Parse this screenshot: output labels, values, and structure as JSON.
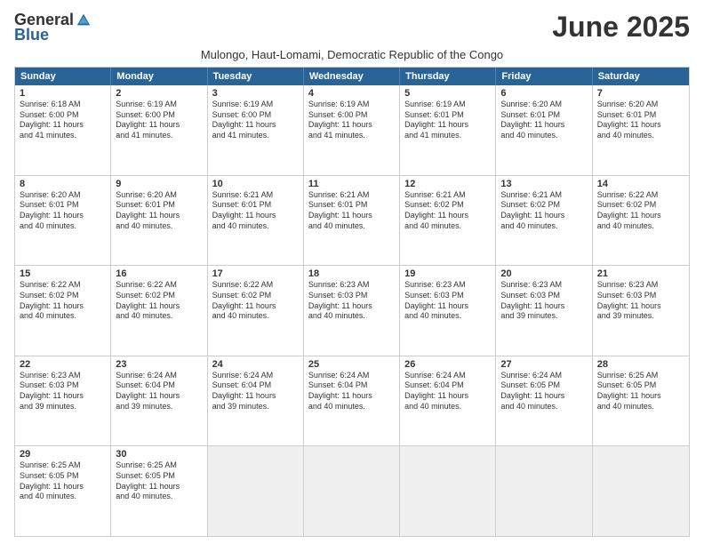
{
  "logo": {
    "general": "General",
    "blue": "Blue"
  },
  "title": "June 2025",
  "subtitle": "Mulongo, Haut-Lomami, Democratic Republic of the Congo",
  "header": {
    "days": [
      "Sunday",
      "Monday",
      "Tuesday",
      "Wednesday",
      "Thursday",
      "Friday",
      "Saturday"
    ]
  },
  "weeks": [
    [
      {
        "day": 1,
        "rise": "6:18 AM",
        "set": "6:00 PM",
        "hours": "11",
        "mins": "41"
      },
      {
        "day": 2,
        "rise": "6:19 AM",
        "set": "6:00 PM",
        "hours": "11",
        "mins": "41"
      },
      {
        "day": 3,
        "rise": "6:19 AM",
        "set": "6:00 PM",
        "hours": "11",
        "mins": "41"
      },
      {
        "day": 4,
        "rise": "6:19 AM",
        "set": "6:00 PM",
        "hours": "11",
        "mins": "41"
      },
      {
        "day": 5,
        "rise": "6:19 AM",
        "set": "6:01 PM",
        "hours": "11",
        "mins": "41"
      },
      {
        "day": 6,
        "rise": "6:20 AM",
        "set": "6:01 PM",
        "hours": "11",
        "mins": "40"
      },
      {
        "day": 7,
        "rise": "6:20 AM",
        "set": "6:01 PM",
        "hours": "11",
        "mins": "40"
      }
    ],
    [
      {
        "day": 8,
        "rise": "6:20 AM",
        "set": "6:01 PM",
        "hours": "11",
        "mins": "40"
      },
      {
        "day": 9,
        "rise": "6:20 AM",
        "set": "6:01 PM",
        "hours": "11",
        "mins": "40"
      },
      {
        "day": 10,
        "rise": "6:21 AM",
        "set": "6:01 PM",
        "hours": "11",
        "mins": "40"
      },
      {
        "day": 11,
        "rise": "6:21 AM",
        "set": "6:01 PM",
        "hours": "11",
        "mins": "40"
      },
      {
        "day": 12,
        "rise": "6:21 AM",
        "set": "6:02 PM",
        "hours": "11",
        "mins": "40"
      },
      {
        "day": 13,
        "rise": "6:21 AM",
        "set": "6:02 PM",
        "hours": "11",
        "mins": "40"
      },
      {
        "day": 14,
        "rise": "6:22 AM",
        "set": "6:02 PM",
        "hours": "11",
        "mins": "40"
      }
    ],
    [
      {
        "day": 15,
        "rise": "6:22 AM",
        "set": "6:02 PM",
        "hours": "11",
        "mins": "40"
      },
      {
        "day": 16,
        "rise": "6:22 AM",
        "set": "6:02 PM",
        "hours": "11",
        "mins": "40"
      },
      {
        "day": 17,
        "rise": "6:22 AM",
        "set": "6:02 PM",
        "hours": "11",
        "mins": "40"
      },
      {
        "day": 18,
        "rise": "6:23 AM",
        "set": "6:03 PM",
        "hours": "11",
        "mins": "40"
      },
      {
        "day": 19,
        "rise": "6:23 AM",
        "set": "6:03 PM",
        "hours": "11",
        "mins": "40"
      },
      {
        "day": 20,
        "rise": "6:23 AM",
        "set": "6:03 PM",
        "hours": "11",
        "mins": "39"
      },
      {
        "day": 21,
        "rise": "6:23 AM",
        "set": "6:03 PM",
        "hours": "11",
        "mins": "39"
      }
    ],
    [
      {
        "day": 22,
        "rise": "6:23 AM",
        "set": "6:03 PM",
        "hours": "11",
        "mins": "39"
      },
      {
        "day": 23,
        "rise": "6:24 AM",
        "set": "6:04 PM",
        "hours": "11",
        "mins": "39"
      },
      {
        "day": 24,
        "rise": "6:24 AM",
        "set": "6:04 PM",
        "hours": "11",
        "mins": "39"
      },
      {
        "day": 25,
        "rise": "6:24 AM",
        "set": "6:04 PM",
        "hours": "11",
        "mins": "40"
      },
      {
        "day": 26,
        "rise": "6:24 AM",
        "set": "6:04 PM",
        "hours": "11",
        "mins": "40"
      },
      {
        "day": 27,
        "rise": "6:24 AM",
        "set": "6:05 PM",
        "hours": "11",
        "mins": "40"
      },
      {
        "day": 28,
        "rise": "6:25 AM",
        "set": "6:05 PM",
        "hours": "11",
        "mins": "40"
      }
    ],
    [
      {
        "day": 29,
        "rise": "6:25 AM",
        "set": "6:05 PM",
        "hours": "11",
        "mins": "40"
      },
      {
        "day": 30,
        "rise": "6:25 AM",
        "set": "6:05 PM",
        "hours": "11",
        "mins": "40"
      },
      null,
      null,
      null,
      null,
      null
    ]
  ]
}
